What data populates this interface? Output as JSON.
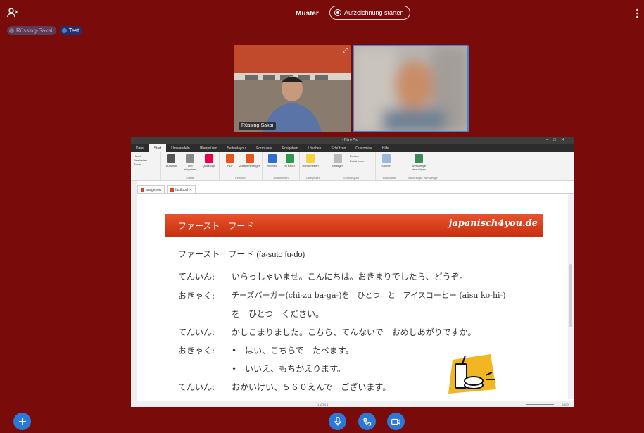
{
  "topbar": {
    "presentation_title": "Muster",
    "record_label": "Aufzeichnung starten"
  },
  "participants_chips": [
    {
      "label": "Rüssing-Sakai"
    },
    {
      "label": "Test"
    }
  ],
  "videos": {
    "left_name": "Rüssing-Sakai"
  },
  "app": {
    "window_title": "- Nitro Pro",
    "menu": [
      "Datei",
      "Start",
      "Umwandeln",
      "Überprüfen",
      "Seitenlayout",
      "Formulare",
      "Freigeben",
      "Löschen",
      "Schützen",
      "Customize",
      "Hilfe"
    ],
    "active_menu_index": 1,
    "ribbon_groups": [
      {
        "name": "Extras",
        "buttons": [
          "Auswahl",
          "Text eingeben",
          "QuickSign"
        ]
      },
      {
        "name": "Erstellen",
        "buttons": [
          "PDF",
          "Zusammenfügen"
        ]
      },
      {
        "name": "Umwandeln",
        "buttons": [
          "In Word",
          "In Excel"
        ]
      },
      {
        "name": "Überprüfen",
        "buttons": [
          "Hervorheben"
        ]
      },
      {
        "name": "Seitenlayout",
        "buttons": [
          "Einfügen",
          "Drehen",
          "Extrahieren"
        ]
      },
      {
        "name": "Dokument",
        "buttons": [
          "Suchen"
        ]
      },
      {
        "name": "Bevorzugte Werkzeuge",
        "buttons": [
          "Werkzeuge hinzufügen"
        ]
      }
    ],
    "left_tools": [
      "Hand",
      "Bearbeiten",
      "Zoom"
    ],
    "tabs": [
      "ausgehen",
      "fastfood"
    ],
    "statusbar_page": "1 VON 1",
    "zoom": "160%"
  },
  "document": {
    "banner_title": "ファースト　フード",
    "brand": "japanisch4you.de",
    "heading_jp": "ファースト　フード",
    "heading_rom": "(fa-suto fu-do)",
    "lines": [
      {
        "speaker": "てんいん:",
        "text": "いらっしゃいませ。こんにちは。おきまりでしたら、どうぞ。"
      },
      {
        "speaker": "おきゃく:",
        "text": "チーズバーガー(chi-zu ba-ga-)を　ひとつ　と　アイスコーヒー (aisu ko-hi-)"
      },
      {
        "speaker": "",
        "text": "を　ひとつ　ください。"
      },
      {
        "speaker": "てんいん:",
        "text": "かしこまりました。こちら、てんないで　おめしあがりですか。"
      },
      {
        "speaker": "おきゃく:",
        "text": "•　はい、こちらで　たべます。"
      },
      {
        "speaker": "",
        "text": "•　いいえ、もちかえります。"
      },
      {
        "speaker": "てんいん:",
        "text": "おかいけい、５６０えんで　ございます。"
      }
    ]
  },
  "colors": {
    "background": "#7a0b0b",
    "accent": "#2b78d8",
    "banner": "#d8401b"
  }
}
